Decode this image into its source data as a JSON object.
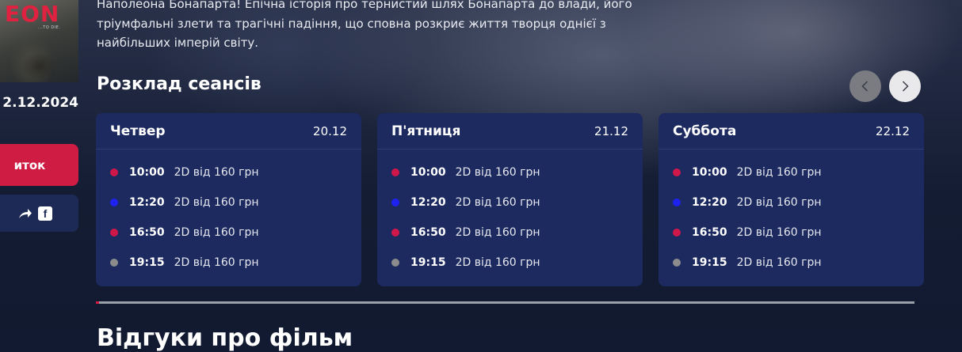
{
  "poster": {
    "logo_text": "EON",
    "tagline": "...TO DIE.",
    "release_date": "2.12.2024"
  },
  "actions": {
    "ticket_label": "иток",
    "share_icon": "share-arrow-icon",
    "facebook_icon_text": "f"
  },
  "description": "Наполеона Бонапарта! Епічна історія про тернистий шлях Бонапарта до влади, його тріумфальні злети та трагічні падіння, що сповна розкриє життя творця однієї з найбільших імперій світу.",
  "schedule": {
    "title": "Розклад сеансів",
    "prev_icon": "chevron-left-icon",
    "next_icon": "chevron-right-icon",
    "days": [
      {
        "name": "Четвер",
        "date": "20.12",
        "sessions": [
          {
            "time": "10:00",
            "info": "2D від 160 грн",
            "color": "#d0174a"
          },
          {
            "time": "12:20",
            "info": "2D від 160 грн",
            "color": "#1e22f0"
          },
          {
            "time": "16:50",
            "info": "2D від 160 грн",
            "color": "#d0174a"
          },
          {
            "time": "19:15",
            "info": "2D від 160 грн",
            "color": "#8c8c8c"
          }
        ]
      },
      {
        "name": "П'ятниця",
        "date": "21.12",
        "sessions": [
          {
            "time": "10:00",
            "info": "2D від 160 грн",
            "color": "#d0174a"
          },
          {
            "time": "12:20",
            "info": "2D від 160 грн",
            "color": "#1e22f0"
          },
          {
            "time": "16:50",
            "info": "2D від 160 грн",
            "color": "#d0174a"
          },
          {
            "time": "19:15",
            "info": "2D від 160 грн",
            "color": "#8c8c8c"
          }
        ]
      },
      {
        "name": "Суббота",
        "date": "22.12",
        "sessions": [
          {
            "time": "10:00",
            "info": "2D від 160 грн",
            "color": "#d0174a"
          },
          {
            "time": "12:20",
            "info": "2D від 160 грн",
            "color": "#1e22f0"
          },
          {
            "time": "16:50",
            "info": "2D від 160 грн",
            "color": "#d0174a"
          },
          {
            "time": "19:15",
            "info": "2D від 160 грн",
            "color": "#8c8c8c"
          }
        ]
      }
    ]
  },
  "reviews": {
    "title": "Відгуки про фільм"
  },
  "colors": {
    "accent": "#cf1c43",
    "card_bg": "#1c2a5f",
    "page_bg": "#111a30"
  }
}
